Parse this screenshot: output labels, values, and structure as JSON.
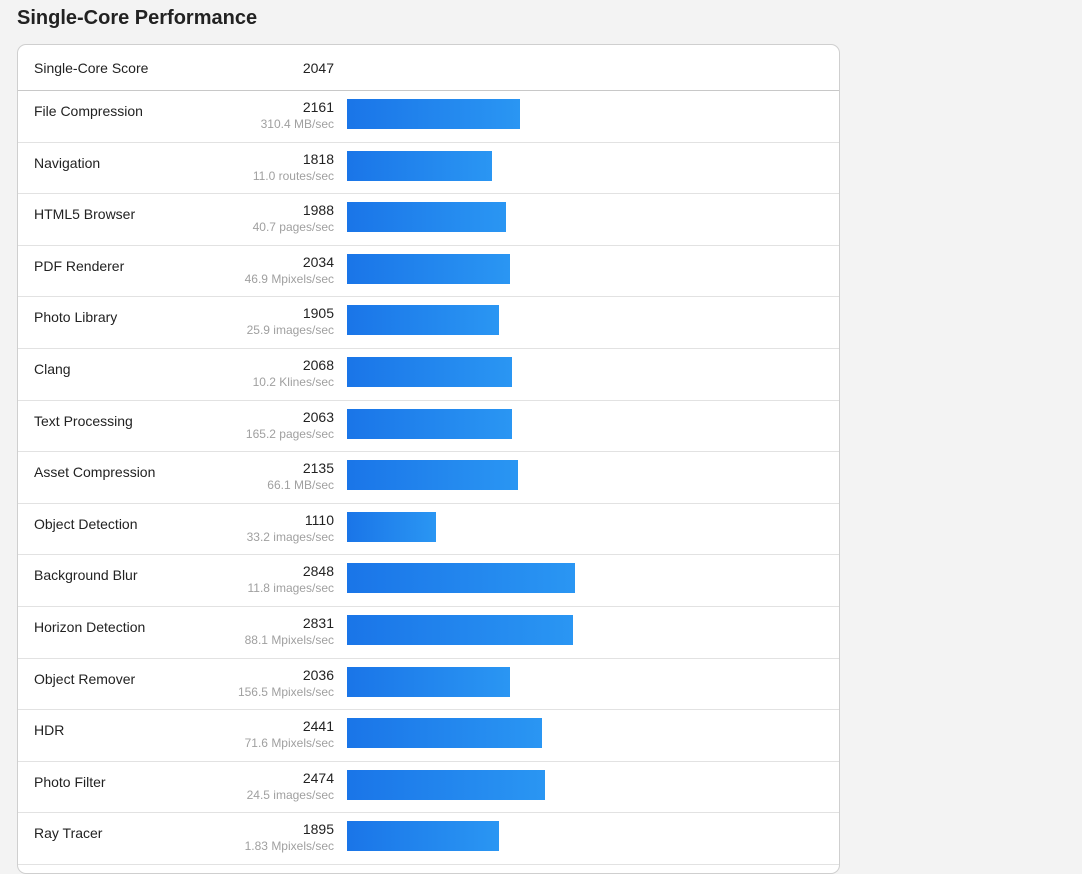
{
  "page": {
    "title": "Single-Core Performance"
  },
  "summary": {
    "label": "Single-Core Score",
    "score": "2047"
  },
  "bar_max": 4000,
  "benchmarks": [
    {
      "name": "File Compression",
      "score": 2161,
      "unit": "310.4 MB/sec"
    },
    {
      "name": "Navigation",
      "score": 1818,
      "unit": "11.0 routes/sec"
    },
    {
      "name": "HTML5 Browser",
      "score": 1988,
      "unit": "40.7 pages/sec"
    },
    {
      "name": "PDF Renderer",
      "score": 2034,
      "unit": "46.9 Mpixels/sec"
    },
    {
      "name": "Photo Library",
      "score": 1905,
      "unit": "25.9 images/sec"
    },
    {
      "name": "Clang",
      "score": 2068,
      "unit": "10.2 Klines/sec"
    },
    {
      "name": "Text Processing",
      "score": 2063,
      "unit": "165.2 pages/sec"
    },
    {
      "name": "Asset Compression",
      "score": 2135,
      "unit": "66.1 MB/sec"
    },
    {
      "name": "Object Detection",
      "score": 1110,
      "unit": "33.2 images/sec"
    },
    {
      "name": "Background Blur",
      "score": 2848,
      "unit": "11.8 images/sec"
    },
    {
      "name": "Horizon Detection",
      "score": 2831,
      "unit": "88.1 Mpixels/sec"
    },
    {
      "name": "Object Remover",
      "score": 2036,
      "unit": "156.5 Mpixels/sec"
    },
    {
      "name": "HDR",
      "score": 2441,
      "unit": "71.6 Mpixels/sec"
    },
    {
      "name": "Photo Filter",
      "score": 2474,
      "unit": "24.5 images/sec"
    },
    {
      "name": "Ray Tracer",
      "score": 1895,
      "unit": "1.83 Mpixels/sec"
    }
  ]
}
